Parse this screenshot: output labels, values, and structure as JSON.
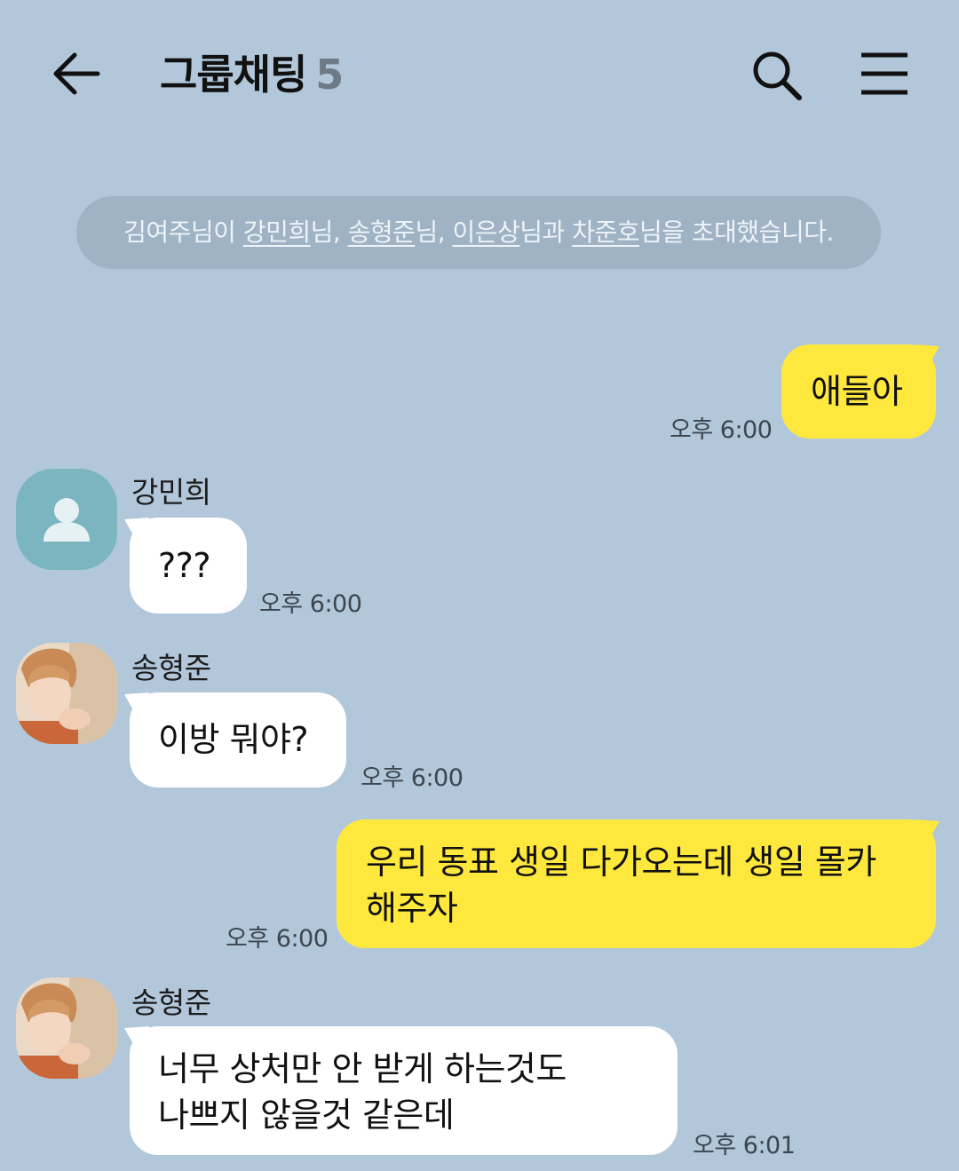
{
  "header": {
    "title": "그룹채팅",
    "member_count": "5",
    "back_icon": "arrow-left-icon",
    "search_icon": "search-icon",
    "menu_icon": "hamburger-menu-icon"
  },
  "system_message": {
    "p1": "김여주님이 ",
    "n1": "강민희",
    "p2": "님, ",
    "n2": "송형준",
    "p3": "님, ",
    "n3": "이은상",
    "p4": "님과 ",
    "n4": "차준호",
    "p5": "님을 초대했습니다."
  },
  "messages": [
    {
      "from": "me",
      "text": "애들아",
      "time": "오후 6:00"
    },
    {
      "from": "강민희",
      "text": "???",
      "time": "오후 6:00"
    },
    {
      "from": "송형준",
      "text": "이방 뭐야?",
      "time": "오후 6:00"
    },
    {
      "from": "me",
      "line1": "우리 동표 생일 다가오는데 생일 몰카",
      "line2": "해주자",
      "time": "오후 6:00"
    },
    {
      "from": "송형준",
      "line1": "너무 상처만 안 받게 하는것도",
      "line2": "나쁘지 않을것 같은데",
      "time": "오후 6:01"
    }
  ],
  "colors": {
    "background": "#b2c7da",
    "my_bubble": "#fee83d",
    "other_bubble": "#ffffff",
    "default_avatar": "#7ab5c0"
  }
}
